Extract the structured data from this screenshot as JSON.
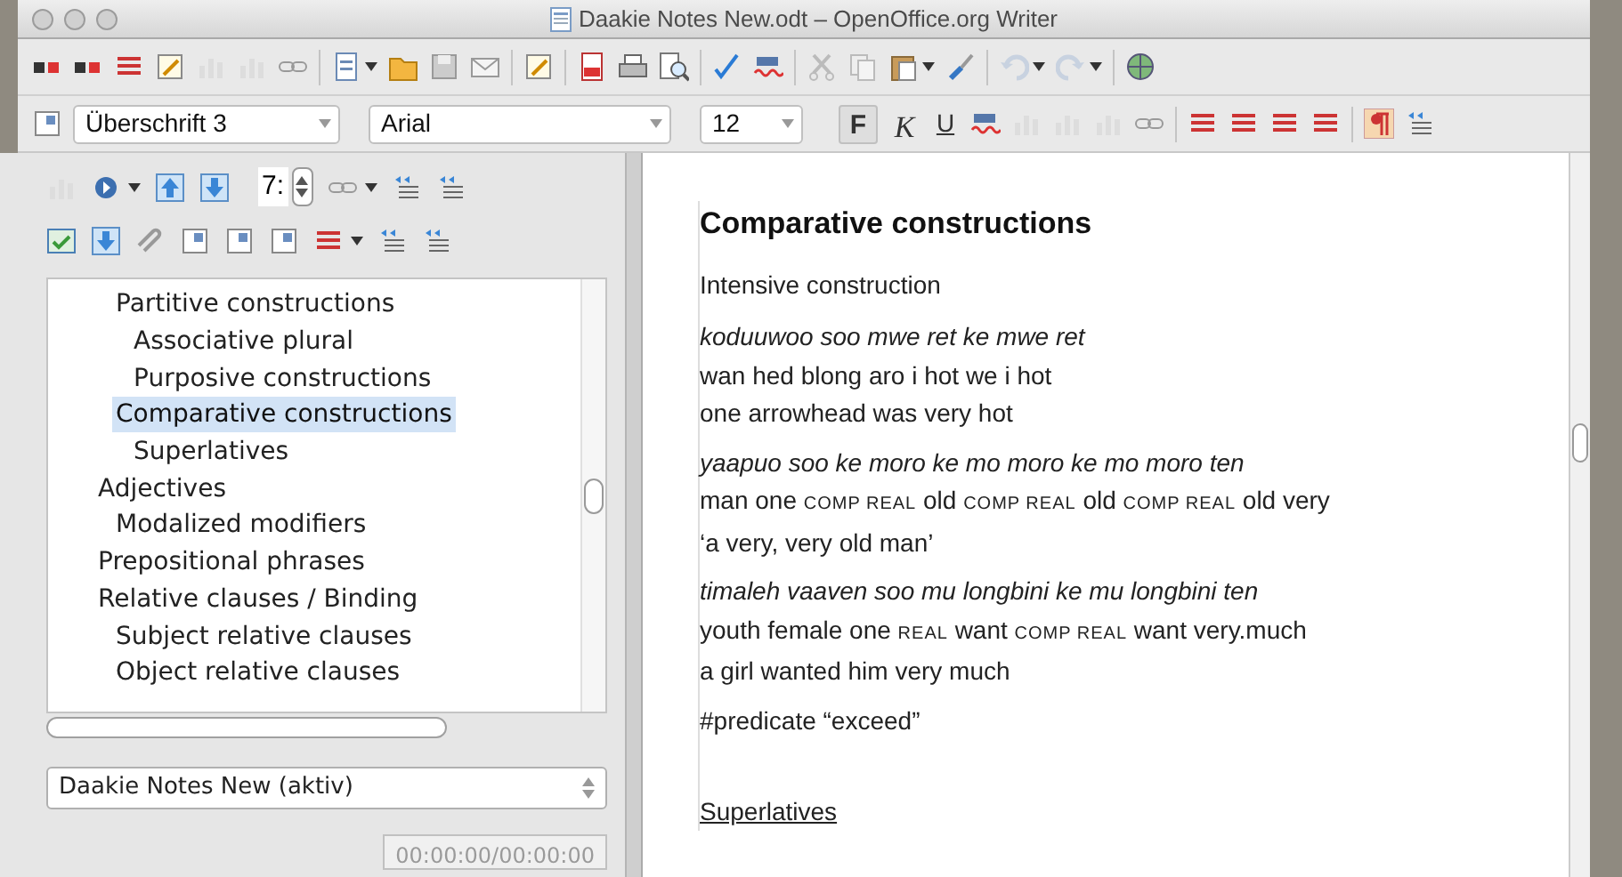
{
  "window": {
    "title": "Daakie Notes New.odt – OpenOffice.org Writer"
  },
  "formatting_toolbar": {
    "paragraph_style": "Überschrift 3",
    "font_name": "Arial",
    "font_size": "12",
    "bold_label": "F",
    "italic_label": "K",
    "underline_label": "U"
  },
  "navigator": {
    "spin_value": "7:",
    "tree": [
      {
        "children": [
          {
            "label": "Partitive constructions",
            "selected": false,
            "children": [
              {
                "label": "Associative plural",
                "selected": false
              },
              {
                "label": "Purposive constructions",
                "selected": false
              }
            ]
          },
          {
            "label": "Comparative constructions",
            "selected": true,
            "children": [
              {
                "label": "Superlatives",
                "selected": false
              }
            ]
          }
        ]
      },
      {
        "label": "Adjectives",
        "selected": false,
        "children": [
          {
            "label": "Modalized modifiers",
            "selected": false
          }
        ]
      },
      {
        "label": "Prepositional phrases",
        "selected": false
      },
      {
        "label": "Relative clauses / Binding",
        "selected": false,
        "children": [
          {
            "label": "Subject relative clauses",
            "selected": false
          },
          {
            "label": "Object relative clauses",
            "selected": false
          }
        ]
      }
    ],
    "document_select": "Daakie Notes New (aktiv)",
    "time": "00:00:00/00:00:00"
  },
  "document": {
    "blocks": [
      {
        "kind": "heading",
        "text": "Comparative constructions"
      },
      {
        "kind": "paragraph",
        "text": "Intensive construction"
      },
      {
        "kind": "example",
        "lines": [
          {
            "kind": "vernacular",
            "segments": [
              {
                "kind": "word",
                "text": "koduuwoo soo mwe ret ke mwe ret"
              }
            ]
          },
          {
            "kind": "gloss",
            "segments": [
              {
                "kind": "word",
                "text": "wan hed blong aro i hot we i hot"
              }
            ]
          },
          {
            "kind": "translation",
            "segments": [
              {
                "kind": "word",
                "text": "one arrowhead was very hot"
              }
            ]
          }
        ]
      },
      {
        "kind": "example",
        "lines": [
          {
            "kind": "vernacular",
            "segments": [
              {
                "kind": "word",
                "text": "yaapuo soo ke moro ke mo moro ke mo moro ten"
              }
            ]
          },
          {
            "kind": "gloss",
            "segments": [
              {
                "kind": "word",
                "text": "man one"
              },
              {
                "kind": "abbr",
                "text": "COMP REAL"
              },
              {
                "kind": "word",
                "text": "old"
              },
              {
                "kind": "abbr",
                "text": "COMP REAL"
              },
              {
                "kind": "word",
                "text": "old"
              },
              {
                "kind": "abbr",
                "text": "COMP REAL"
              },
              {
                "kind": "word",
                "text": "old very"
              }
            ]
          },
          {
            "kind": "translation",
            "segments": [
              {
                "kind": "word",
                "text": "‘a very, very old man’"
              }
            ]
          }
        ]
      },
      {
        "kind": "example",
        "lines": [
          {
            "kind": "vernacular",
            "segments": [
              {
                "kind": "word",
                "text": "timaleh vaaven soo mu longbini ke mu longbini ten"
              }
            ]
          },
          {
            "kind": "gloss",
            "segments": [
              {
                "kind": "word",
                "text": "youth female one"
              },
              {
                "kind": "abbr",
                "text": "REAL"
              },
              {
                "kind": "word",
                "text": "want"
              },
              {
                "kind": "abbr",
                "text": "COMP REAL"
              },
              {
                "kind": "word",
                "text": "want very.much"
              }
            ]
          },
          {
            "kind": "translation",
            "segments": [
              {
                "kind": "word",
                "text": "a girl wanted him very much"
              }
            ]
          }
        ]
      },
      {
        "kind": "paragraph",
        "text": "#predicate “exceed”"
      },
      {
        "kind": "subheading",
        "text": "Superlatives"
      }
    ]
  }
}
